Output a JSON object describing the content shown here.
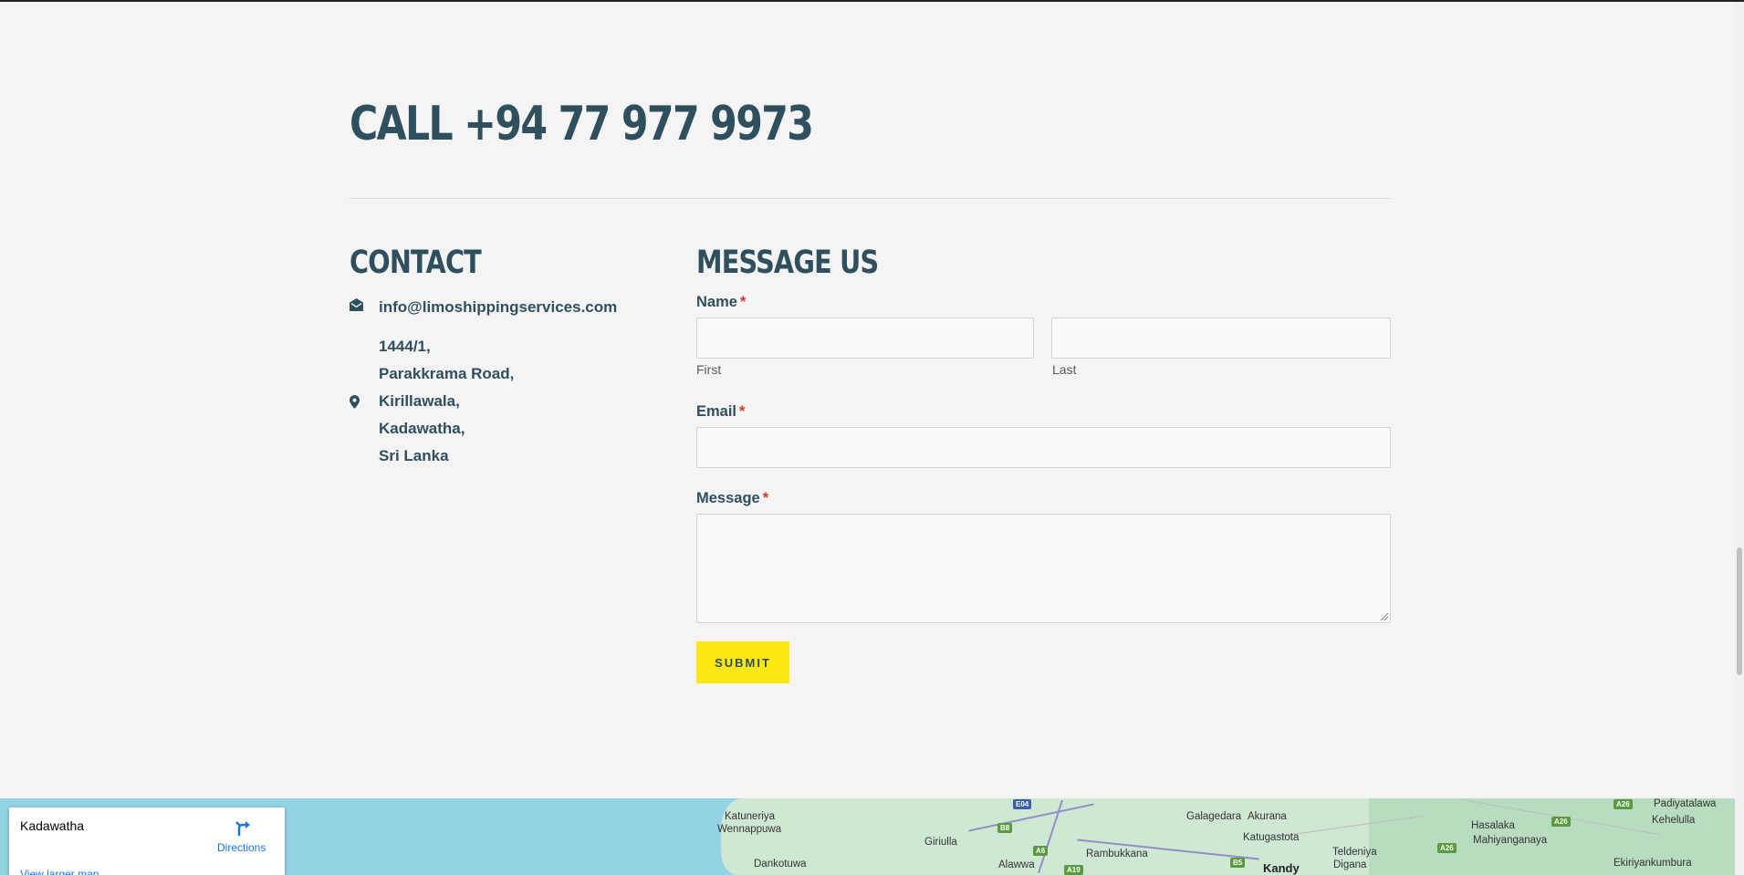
{
  "hero": {
    "call_text": "CALL +94 77 977 9973"
  },
  "contact": {
    "title": "CONTACT",
    "email": "info@limoshippingservices.com",
    "address_lines": [
      "1444/1,",
      "Parakkrama Road,",
      "Kirillawala,",
      "Kadawatha,",
      "Sri Lanka"
    ],
    "email_icon": "envelope-open-icon",
    "address_icon": "map-pin-icon"
  },
  "form": {
    "title": "MESSAGE US",
    "name_label": "Name",
    "required_marker": "*",
    "first_label": "First",
    "last_label": "Last",
    "email_label": "Email",
    "message_label": "Message",
    "submit_label": "SUBMIT"
  },
  "map": {
    "place_name": "Kadawatha",
    "directions_label": "Directions",
    "larger_map_label": "View larger map",
    "labels": {
      "katuneriya": "Katuneriya",
      "wennappuwa": "Wennappuwa",
      "dankotuwa": "Dankotuwa",
      "giriulla": "Giriulla",
      "alawwa": "Alawwa",
      "rambukkana": "Rambukkana",
      "galagedara": "Galagedara",
      "akurana": "Akurana",
      "katugastota": "Katugastota",
      "kandy": "Kandy",
      "hasalaka": "Hasalaka",
      "mahiyanganaya": "Mahiyanganaya",
      "padiyatalawa": "Padiyatalawa",
      "kehelulla": "Kehelulla",
      "teldeniya": "Teldeniya",
      "digana": "Digana",
      "ekiriyankumbura": "Ekiriyankumbura"
    },
    "shields": {
      "e04": "E04",
      "b8": "B8",
      "a6": "A6",
      "a19": "A19",
      "b5": "B5",
      "a26a": "A26",
      "a26b": "A26",
      "a26c": "A26"
    },
    "colors": {
      "water": "#94d3e3",
      "land": "#cfe8d3",
      "link": "#1a73e8"
    }
  },
  "colors": {
    "heading": "#2f4f5e",
    "submit_bg": "#fbe711",
    "required": "#d9342b",
    "page_bg": "#f4f4f4"
  }
}
